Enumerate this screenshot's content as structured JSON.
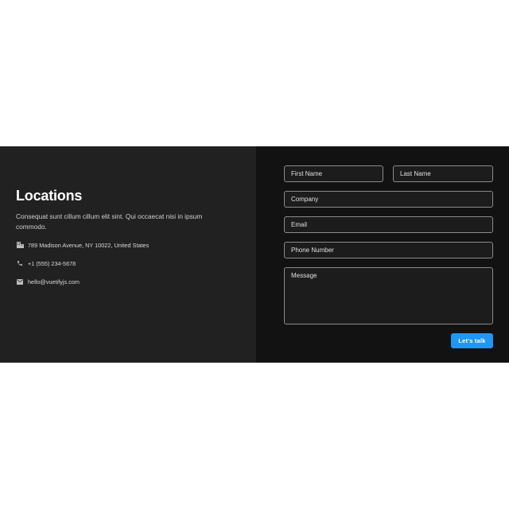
{
  "locations": {
    "title": "Locations",
    "description": "Consequat sunt cillum cillum elit sint. Qui occaecat nisi in ipsum commodo.",
    "items": [
      {
        "icon": "building-icon",
        "text": "789 Madison Avenue, NY 10022, United States"
      },
      {
        "icon": "phone-icon",
        "text": "+1 (555) 234-5678"
      },
      {
        "icon": "email-icon",
        "text": "hello@vuetifyjs.com"
      }
    ]
  },
  "form": {
    "first_name_label": "First Name",
    "last_name_label": "Last Name",
    "company_label": "Company",
    "email_label": "Email",
    "phone_label": "Phone Number",
    "message_label": "Message",
    "submit_label": "Let's talk"
  },
  "colors": {
    "left_panel": "#212121",
    "right_panel": "#121212",
    "accent": "#2196f3"
  }
}
